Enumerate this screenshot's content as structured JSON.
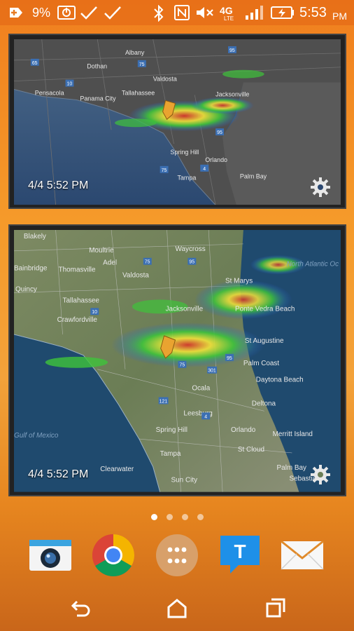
{
  "status_bar": {
    "battery_saver_label": "9%",
    "time": "5:53",
    "ampm": "PM",
    "network": "4G",
    "network_sub": "LTE",
    "icons": [
      "add-notification-icon",
      "battery-saver-icon",
      "check-icon",
      "check-icon",
      "bluetooth-icon",
      "nfc-icon",
      "mute-icon",
      "signal-icon",
      "battery-charging-icon"
    ]
  },
  "widgets": [
    {
      "timestamp": "4/4 5:52 PM",
      "map_labels": [
        "Albany",
        "Dothan",
        "Valdosta",
        "Tallahassee",
        "Pensacola",
        "Panama City",
        "Jacksonville",
        "Orlando",
        "Tampa",
        "Palm Bay",
        "Spring Hill"
      ],
      "highway_labels": [
        "65",
        "10",
        "75",
        "95",
        "75",
        "4",
        "95"
      ]
    },
    {
      "timestamp": "4/4 5:52 PM",
      "map_labels": [
        "Blakely",
        "Moultrie",
        "Waycross",
        "Thomasville",
        "Adel",
        "Bainbridge",
        "Valdosta",
        "Quincy",
        "Tallahassee",
        "Crawfordville",
        "Jacksonville",
        "St Marys",
        "Ponte Vedra Beach",
        "St Augustine",
        "Palm Coast",
        "Daytona Beach",
        "Ocala",
        "Deltona",
        "Leesburg",
        "Spring Hill",
        "Orlando",
        "Merritt Island",
        "St Cloud",
        "Clearwater",
        "Tampa",
        "Sun City",
        "Palm Bay",
        "Sebastian",
        "Gulf of Mexico",
        "North Atlantic Oc"
      ],
      "highway_labels": [
        "75",
        "95",
        "10",
        "121",
        "4",
        "301",
        "95",
        "75"
      ]
    }
  ],
  "page_indicator": {
    "count": 4,
    "active": 0
  },
  "dock": [
    {
      "name": "camera-app",
      "icon": "camera-icon"
    },
    {
      "name": "chrome-app",
      "icon": "chrome-icon"
    },
    {
      "name": "app-drawer",
      "icon": "apps-grid-icon"
    },
    {
      "name": "messaging-app",
      "icon": "message-icon",
      "letter": "T"
    },
    {
      "name": "email-app",
      "icon": "mail-icon"
    }
  ],
  "nav": [
    "back-icon",
    "home-icon",
    "recents-icon"
  ],
  "colors": {
    "accent": "#f0851e",
    "radar_green": "#3ec33b",
    "radar_yellow": "#f2e23a",
    "radar_blue": "#2a5ae0",
    "radar_red": "#d8352a"
  }
}
